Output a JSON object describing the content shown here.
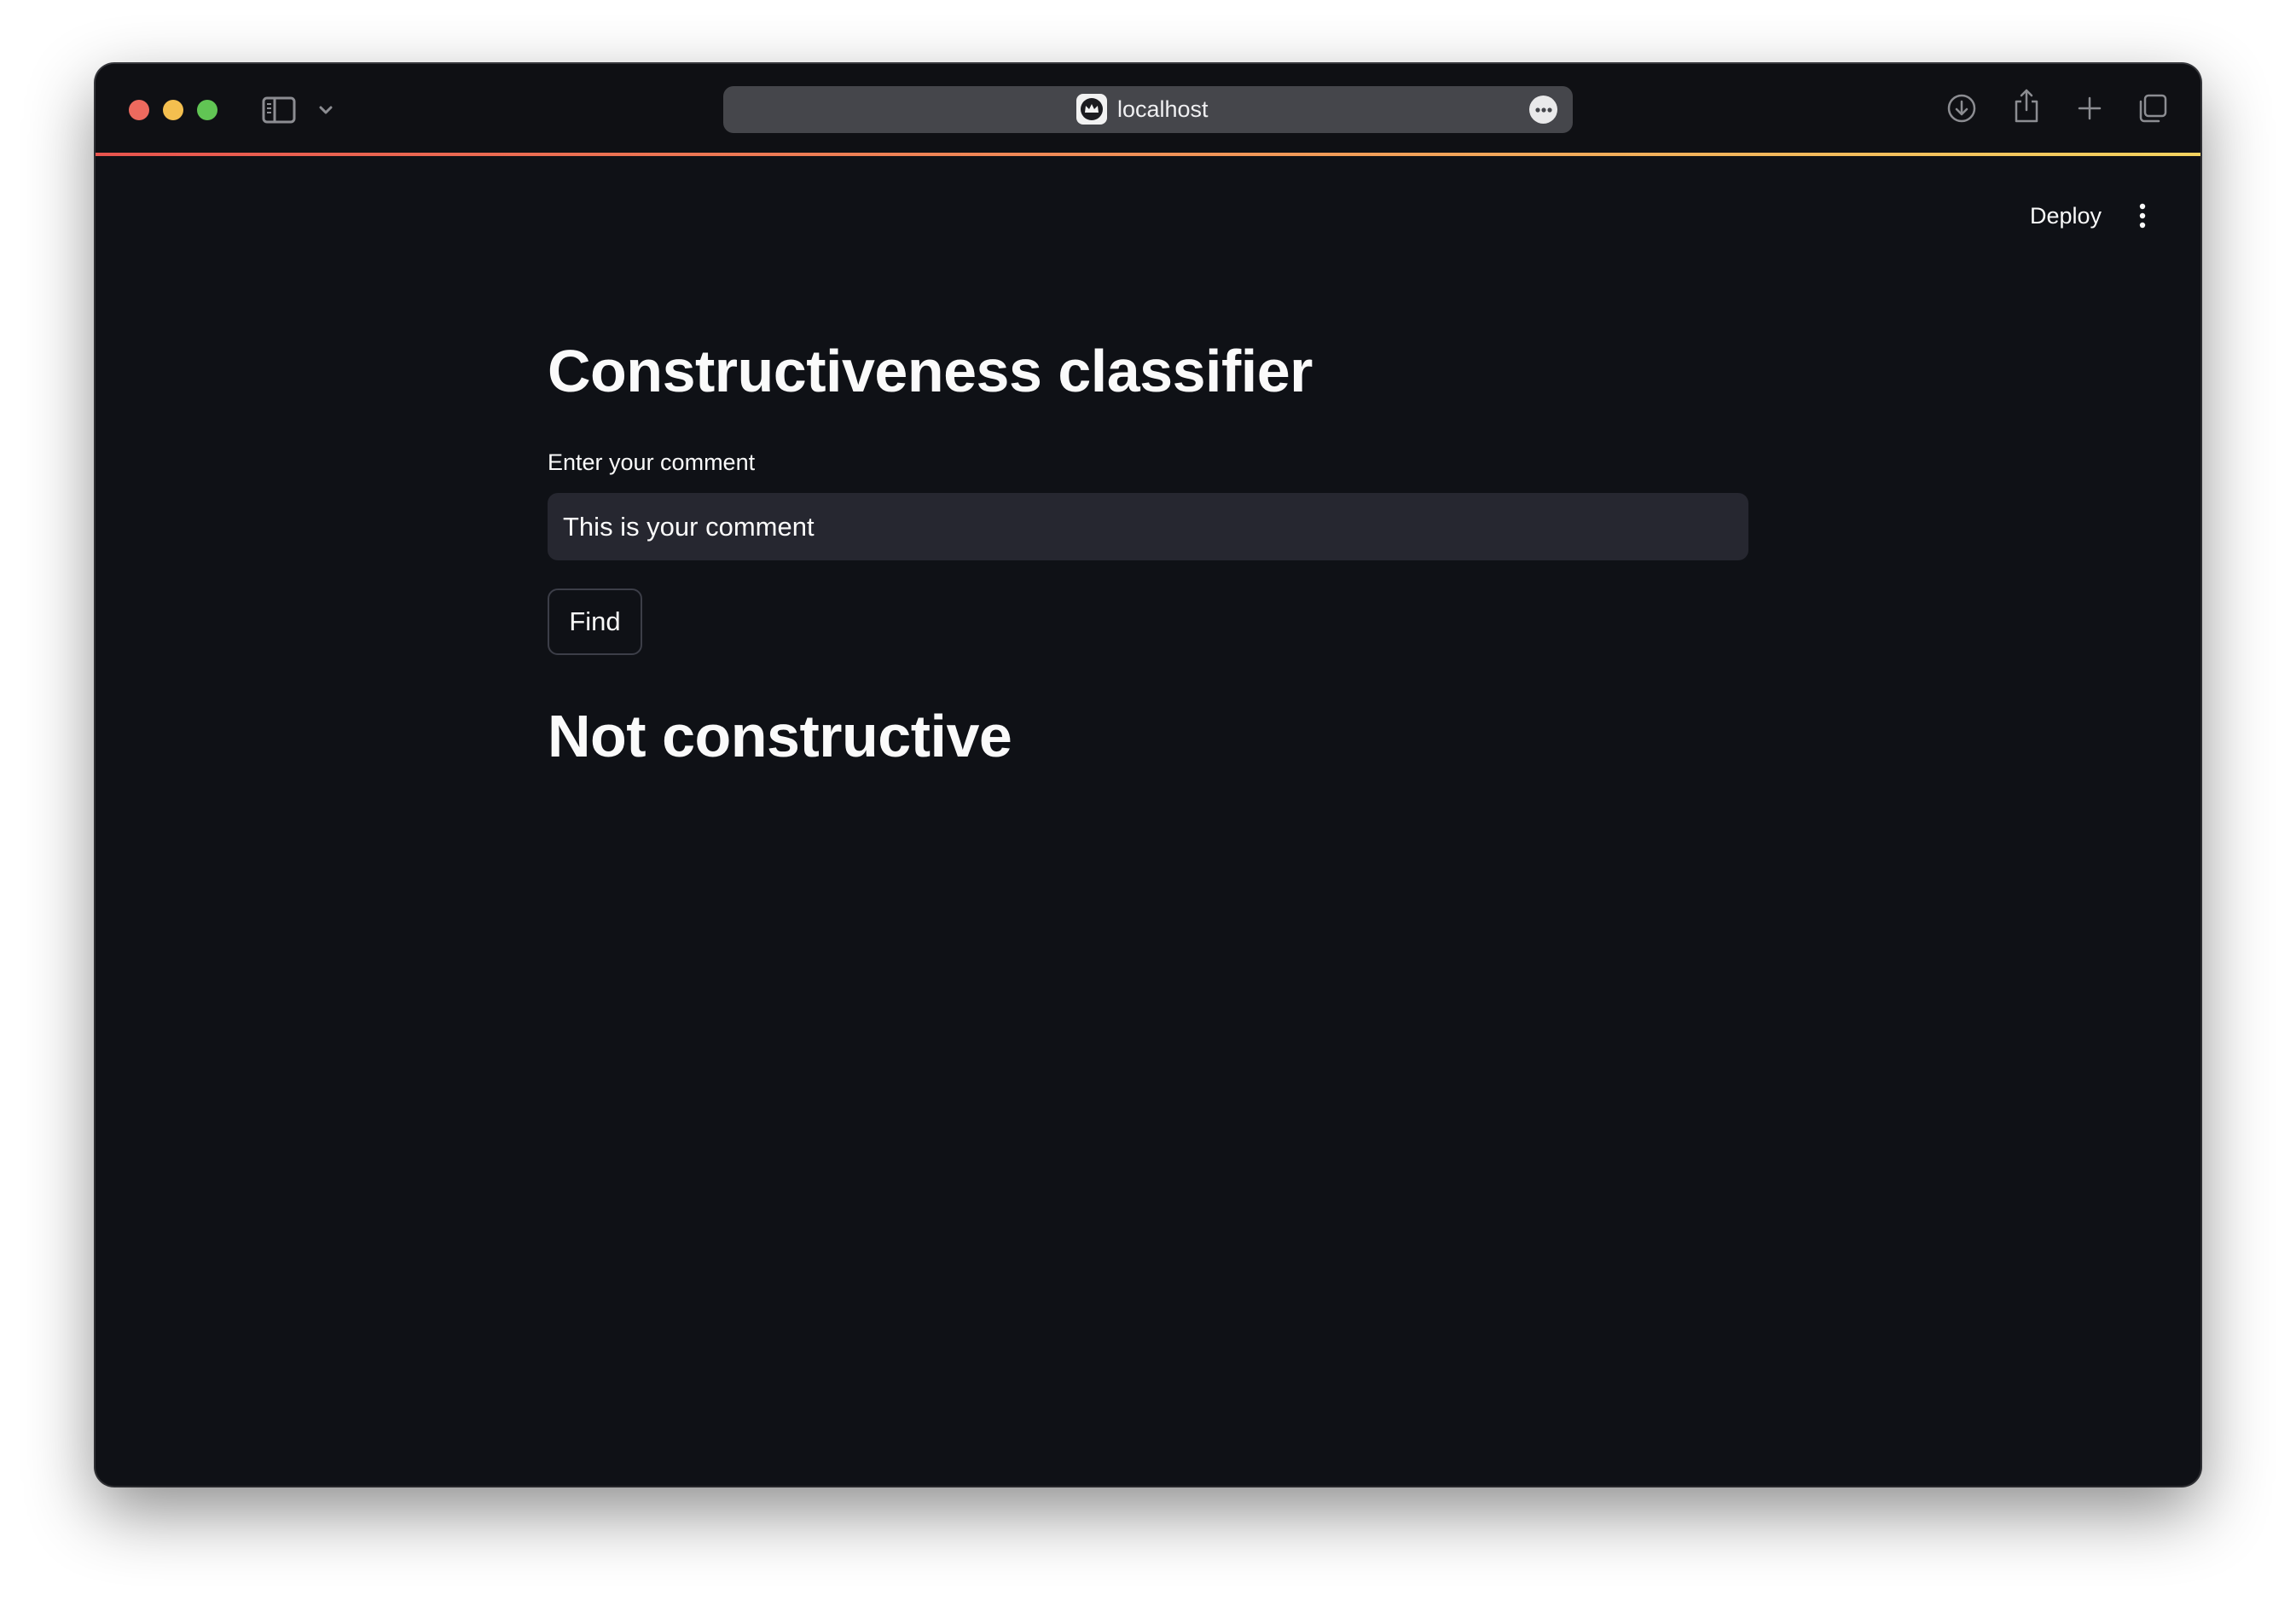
{
  "browser": {
    "url": "localhost",
    "accent_colors": [
      "#e8544e",
      "#f08a56",
      "#f5d35f"
    ],
    "icons": {
      "sidebar_toggle": "sidebar-icon",
      "dropdown": "chevron-down-icon",
      "site": "streamlit-crown-icon",
      "page_menu": "ellipsis-circle-icon",
      "download": "download-icon",
      "share": "share-icon",
      "new_tab": "plus-icon",
      "tab_overview": "tabs-icon"
    }
  },
  "app_header": {
    "deploy_label": "Deploy",
    "menu_icon": "kebab-menu-icon"
  },
  "main": {
    "title": "Constructiveness classifier",
    "input_label": "Enter your comment",
    "input_value": "This is your comment",
    "button_label": "Find",
    "result": "Not constructive"
  },
  "colors": {
    "background": "#0f1116",
    "input_background": "#262730",
    "text": "#fafafa"
  }
}
